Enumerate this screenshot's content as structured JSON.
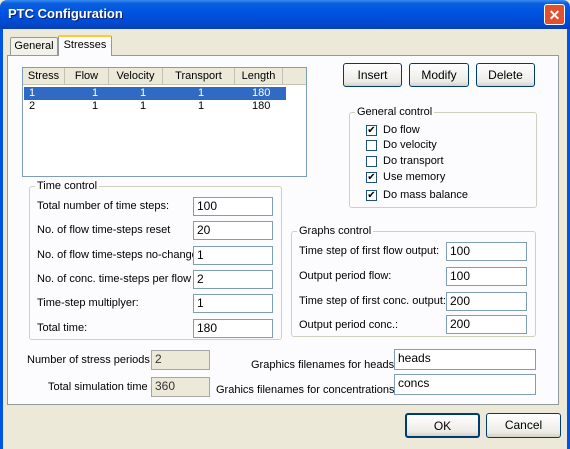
{
  "window": {
    "title": "PTC Configuration"
  },
  "tabs": [
    {
      "label": "General"
    },
    {
      "label": "Stresses"
    }
  ],
  "stress_table": {
    "columns": [
      "Stress",
      "Flow",
      "Velocity",
      "Transport",
      "Length"
    ],
    "rows": [
      [
        "1",
        "1",
        "1",
        "1",
        "180"
      ],
      [
        "2",
        "1",
        "1",
        "1",
        "180"
      ]
    ]
  },
  "buttons": {
    "insert": "Insert",
    "modify": "Modify",
    "delete": "Delete",
    "ok": "OK",
    "cancel": "Cancel"
  },
  "general_control": {
    "title": "General control",
    "items": [
      {
        "label": "Do flow",
        "checked": true
      },
      {
        "label": "Do velocity",
        "checked": false
      },
      {
        "label": "Do transport",
        "checked": false
      },
      {
        "label": "Use memory",
        "checked": true
      },
      {
        "label": "Do mass balance",
        "checked": true
      }
    ]
  },
  "time_control": {
    "title": "Time control",
    "fields": [
      {
        "label": "Total number of time steps:",
        "value": "100"
      },
      {
        "label": "No. of flow time-steps reset",
        "value": "20"
      },
      {
        "label": "No. of flow time-steps no-change",
        "value": "1"
      },
      {
        "label": "No. of conc. time-steps per flow",
        "value": "2"
      },
      {
        "label": "Time-step multiplyer:",
        "value": "1"
      },
      {
        "label": "Total time:",
        "value": "180"
      }
    ]
  },
  "graphs_control": {
    "title": "Graphs control",
    "fields": [
      {
        "label": "Time step of first flow output:",
        "value": "100"
      },
      {
        "label": "Output period flow:",
        "value": "100"
      },
      {
        "label": "Time step of first conc. output:",
        "value": "200"
      },
      {
        "label": "Output period conc.:",
        "value": "200"
      }
    ]
  },
  "summary": {
    "stress_periods_label": "Number of stress periods",
    "stress_periods_value": "2",
    "total_time_label": "Total simulation time",
    "total_time_value": "360"
  },
  "filenames": {
    "heads_label": "Graphics filenames for heads:",
    "heads_value": "heads",
    "conc_label": "Grahics filenames for concentrations:",
    "conc_value": "concs"
  }
}
